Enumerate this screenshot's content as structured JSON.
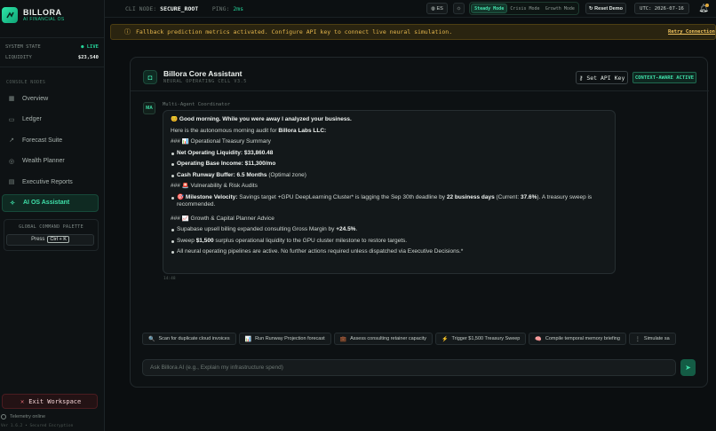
{
  "brand": {
    "name": "BILLORA",
    "subtitle": "AI FINANCIAL OS"
  },
  "system": {
    "state_label": "SYSTEM STATE",
    "state_value": "● LIVE",
    "liquidity_label": "LIQUIDITY",
    "liquidity_value": "$23,540"
  },
  "sidebar": {
    "section_label": "CONSOLE NODES",
    "items": [
      {
        "label": "Overview",
        "icon": "grid-icon",
        "glyph": "▦"
      },
      {
        "label": "Ledger",
        "icon": "ledger-icon",
        "glyph": "▭"
      },
      {
        "label": "Forecast Suite",
        "icon": "trend-icon",
        "glyph": "↗"
      },
      {
        "label": "Wealth Planner",
        "icon": "target-icon",
        "glyph": "◎"
      },
      {
        "label": "Executive Reports",
        "icon": "report-icon",
        "glyph": "▤"
      },
      {
        "label": "AI OS Assistant",
        "icon": "sparkle-icon",
        "glyph": "✧"
      }
    ],
    "palette_label": "GLOBAL COMMAND PALETTE",
    "palette_press": "Press",
    "palette_key": "Ctrl + K",
    "exit_label": "Exit Workspace",
    "telemetry": "Telemetry online",
    "version": "Ver 1.6.2 • Secured Encryption"
  },
  "topbar": {
    "cli_label": "CLI NODE:",
    "cli_value": "SECURE_ROOT",
    "ping_label": "PING:",
    "ping_value": "2ms",
    "lang": "ES",
    "modes": [
      "Steady Mode",
      "Crisis Mode",
      "Growth Mode"
    ],
    "reset": "Reset Demo",
    "utc": "UTC: 2026-07-16"
  },
  "alert": {
    "message": "Fallback prediction metrics activated. Configure API key to connect live neural simulation.",
    "action": "Retry Connection"
  },
  "assistant": {
    "title": "Billora Core Assistant",
    "subtitle": "NEURAL OPERATING CELL V3.5",
    "api_key_button": "Set API Key",
    "context_badge": "CONTEXT-AWARE ACTIVE",
    "avatar": "MA",
    "coordinator": "Multi-Agent Coordinator",
    "timestamp": "14:48",
    "message": {
      "greeting": "😊 Good morning. While you were away I analyzed your business.",
      "intro_pre": "Here is the autonomous morning audit for ",
      "intro_bold": "Billora Labs LLC:",
      "h1": "### 📊 Operational Treasury Summary",
      "s1_label": "Net Operating Liquidity:",
      "s1_value": "$33,860.48",
      "s2_label": "Operating Base Income:",
      "s2_value": "$11,300/mo",
      "s3_label": "Cash Runway Buffer:",
      "s3_value": "6.5 Months",
      "s3_note": "(Optimal zone)",
      "h2": "### 🚨 Vulnerability & Risk Audits",
      "v_icon": "🎯",
      "v_label": "Milestone Velocity:",
      "v_text1": " Savings target +GPU DeepLearning Cluster* is lagging the Sep 30th deadline by ",
      "v_bold1": "22 business days",
      "v_text2": " (Current: ",
      "v_bold2": "37.6%",
      "v_text3": "). A treasury sweep is recommended.",
      "h3": "### 📈 Growth & Capital Planner Advice",
      "g1_pre": "Supabase upsell billing expanded consulting Gross Margin by ",
      "g1_bold": "+24.5%",
      "g1_post": ".",
      "g2_pre": "Sweep ",
      "g2_bold": "$1,500",
      "g2_post": " surplus operational liquidity to the GPU cluster milestone to restore targets.",
      "g3": "All neural operating pipelines are active. No further actions required unless dispatched via Executive Decisions.*"
    },
    "chips": [
      {
        "icon": "🔍",
        "label": "Scan for duplicate cloud invoices"
      },
      {
        "icon": "📊",
        "label": "Run Runway Projection forecast"
      },
      {
        "icon": "💼",
        "label": "Assess consulting retainer capacity"
      },
      {
        "icon": "⚡",
        "label": "Trigger $1,500 Treasury Sweep"
      },
      {
        "icon": "🧠",
        "label": "Compile temporal memory briefing"
      },
      {
        "icon": "⋮",
        "label": "Simulate sa"
      }
    ],
    "input_placeholder": "Ask Billora AI (e.g., Explain my infrastructure spend)"
  }
}
